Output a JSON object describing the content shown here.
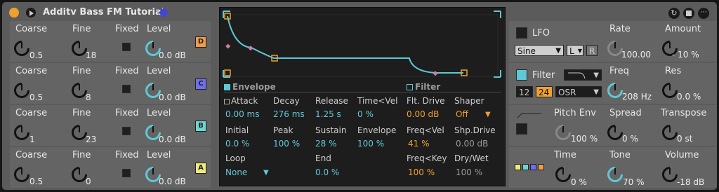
{
  "header": {
    "title": "Additv Bass FM Tutorial"
  },
  "oscillators": [
    {
      "coarse_label": "Coarse",
      "fine_label": "Fine",
      "fixed_label": "Fixed",
      "level_label": "Level",
      "coarse": "0.5",
      "fine": "18",
      "level": "0.0 dB",
      "tag": "D",
      "tag_color": "#f29b48"
    },
    {
      "coarse_label": "Coarse",
      "fine_label": "Fine",
      "fixed_label": "Fixed",
      "level_label": "Level",
      "coarse": "0.5",
      "fine": "8",
      "level": "0.0 dB",
      "tag": "C",
      "tag_color": "#6f6ff0"
    },
    {
      "coarse_label": "Coarse",
      "fine_label": "Fine",
      "fixed_label": "Fixed",
      "level_label": "Level",
      "coarse": "1",
      "fine": "23",
      "level": "0.0 dB",
      "tag": "B",
      "tag_color": "#6cd7cf"
    },
    {
      "coarse_label": "Coarse",
      "fine_label": "Fine",
      "fixed_label": "Fixed",
      "level_label": "Level",
      "coarse": "0.5",
      "fine": "0",
      "level": "0.0 dB",
      "tag": "A",
      "tag_color": "#f0ea7c"
    }
  ],
  "envelope": {
    "title": "Envelope",
    "attack_label": "Attack",
    "attack": "0.00 ms",
    "decay_label": "Decay",
    "decay": "276 ms",
    "release_label": "Release",
    "release": "1.25 s",
    "timevel_label": "Time<Vel",
    "timevel": "0 %",
    "initial_label": "Initial",
    "initial": "0.0 %",
    "peak_label": "Peak",
    "peak": "100 %",
    "sustain_label": "Sustain",
    "sustain": "28 %",
    "envelope_label": "Envelope",
    "envelope": "100 %",
    "loop_label": "Loop",
    "loop": "None",
    "end_label": "End",
    "end": "0.0 %"
  },
  "filter_section": {
    "title": "Filter",
    "drive_label": "Flt. Drive",
    "drive": "0.00 dB",
    "shaper_label": "Shaper",
    "shaper": "Off",
    "freqvel_label": "Freq<Vel",
    "freqvel": "41 %",
    "shpdrive_label": "Shp.Drive",
    "shpdrive": "0.00 dB",
    "freqkey_label": "Freq<Key",
    "freqkey": "100 %",
    "drywet_label": "Dry/Wet",
    "drywet": "100 %"
  },
  "lfo": {
    "label": "LFO",
    "wave": "Sine",
    "mode": "L",
    "retrig": "R",
    "rate_label": "Rate",
    "rate": "100.00",
    "amount_label": "Amount",
    "amount": "- 10 %"
  },
  "filter": {
    "label": "Filter",
    "slope12": "12",
    "slope24": "24",
    "osr": "OSR",
    "freq_label": "Freq",
    "freq": "208 Hz",
    "res_label": "Res",
    "res": "0.0 %"
  },
  "pitch": {
    "pitchenv_label": "Pitch Env",
    "pitchenv": "100 %",
    "spread_label": "Spread",
    "spread": "0 %",
    "transpose_label": "Transpose",
    "transpose": "0 st"
  },
  "output": {
    "time_label": "Time",
    "time": "0 %",
    "tone_label": "Tone",
    "tone": "70 %",
    "volume_label": "Volume",
    "volume": "-18 dB"
  },
  "colors": {
    "accent": "#5ec9d6",
    "orange": "#f0a030",
    "envelope_line": "#5ec9d6"
  }
}
